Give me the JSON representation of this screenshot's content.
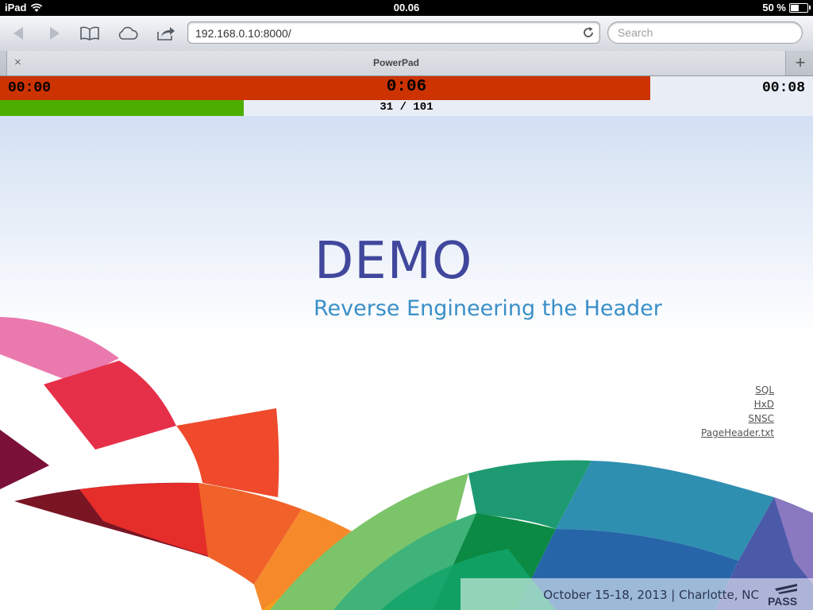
{
  "status": {
    "device": "iPad",
    "time": "00.06",
    "battery": "50 %",
    "battery_level": 0.5
  },
  "browser": {
    "url": "192.168.0.10:8000/",
    "search_placeholder": "Search",
    "tab_title": "PowerPad",
    "tab_close": "×",
    "new_tab": "+"
  },
  "timer": {
    "elapsed": "00:00",
    "current": "0:06",
    "total": "00:08",
    "time_fraction": 0.8,
    "slide_progress": "31 / 101",
    "slide_fraction": 0.3,
    "colors": {
      "timer": "#cc3300",
      "progress": "#4caf00"
    }
  },
  "slide": {
    "title": "DEMO",
    "subtitle": "Reverse Engineering the Header",
    "links": [
      "SQL",
      "HxD",
      "SNSC",
      "PageHeader.txt"
    ],
    "footer": "October 15-18, 2013 | Charlotte, NC",
    "logo_text": "PASS"
  }
}
